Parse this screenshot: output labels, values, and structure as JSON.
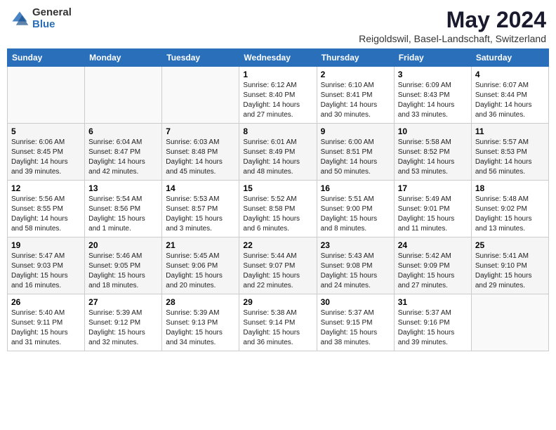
{
  "header": {
    "logo_general": "General",
    "logo_blue": "Blue",
    "month_year": "May 2024",
    "location": "Reigoldswil, Basel-Landschaft, Switzerland"
  },
  "weekdays": [
    "Sunday",
    "Monday",
    "Tuesday",
    "Wednesday",
    "Thursday",
    "Friday",
    "Saturday"
  ],
  "weeks": [
    [
      {
        "day": "",
        "info": ""
      },
      {
        "day": "",
        "info": ""
      },
      {
        "day": "",
        "info": ""
      },
      {
        "day": "1",
        "info": "Sunrise: 6:12 AM\nSunset: 8:40 PM\nDaylight: 14 hours\nand 27 minutes."
      },
      {
        "day": "2",
        "info": "Sunrise: 6:10 AM\nSunset: 8:41 PM\nDaylight: 14 hours\nand 30 minutes."
      },
      {
        "day": "3",
        "info": "Sunrise: 6:09 AM\nSunset: 8:43 PM\nDaylight: 14 hours\nand 33 minutes."
      },
      {
        "day": "4",
        "info": "Sunrise: 6:07 AM\nSunset: 8:44 PM\nDaylight: 14 hours\nand 36 minutes."
      }
    ],
    [
      {
        "day": "5",
        "info": "Sunrise: 6:06 AM\nSunset: 8:45 PM\nDaylight: 14 hours\nand 39 minutes."
      },
      {
        "day": "6",
        "info": "Sunrise: 6:04 AM\nSunset: 8:47 PM\nDaylight: 14 hours\nand 42 minutes."
      },
      {
        "day": "7",
        "info": "Sunrise: 6:03 AM\nSunset: 8:48 PM\nDaylight: 14 hours\nand 45 minutes."
      },
      {
        "day": "8",
        "info": "Sunrise: 6:01 AM\nSunset: 8:49 PM\nDaylight: 14 hours\nand 48 minutes."
      },
      {
        "day": "9",
        "info": "Sunrise: 6:00 AM\nSunset: 8:51 PM\nDaylight: 14 hours\nand 50 minutes."
      },
      {
        "day": "10",
        "info": "Sunrise: 5:58 AM\nSunset: 8:52 PM\nDaylight: 14 hours\nand 53 minutes."
      },
      {
        "day": "11",
        "info": "Sunrise: 5:57 AM\nSunset: 8:53 PM\nDaylight: 14 hours\nand 56 minutes."
      }
    ],
    [
      {
        "day": "12",
        "info": "Sunrise: 5:56 AM\nSunset: 8:55 PM\nDaylight: 14 hours\nand 58 minutes."
      },
      {
        "day": "13",
        "info": "Sunrise: 5:54 AM\nSunset: 8:56 PM\nDaylight: 15 hours\nand 1 minute."
      },
      {
        "day": "14",
        "info": "Sunrise: 5:53 AM\nSunset: 8:57 PM\nDaylight: 15 hours\nand 3 minutes."
      },
      {
        "day": "15",
        "info": "Sunrise: 5:52 AM\nSunset: 8:58 PM\nDaylight: 15 hours\nand 6 minutes."
      },
      {
        "day": "16",
        "info": "Sunrise: 5:51 AM\nSunset: 9:00 PM\nDaylight: 15 hours\nand 8 minutes."
      },
      {
        "day": "17",
        "info": "Sunrise: 5:49 AM\nSunset: 9:01 PM\nDaylight: 15 hours\nand 11 minutes."
      },
      {
        "day": "18",
        "info": "Sunrise: 5:48 AM\nSunset: 9:02 PM\nDaylight: 15 hours\nand 13 minutes."
      }
    ],
    [
      {
        "day": "19",
        "info": "Sunrise: 5:47 AM\nSunset: 9:03 PM\nDaylight: 15 hours\nand 16 minutes."
      },
      {
        "day": "20",
        "info": "Sunrise: 5:46 AM\nSunset: 9:05 PM\nDaylight: 15 hours\nand 18 minutes."
      },
      {
        "day": "21",
        "info": "Sunrise: 5:45 AM\nSunset: 9:06 PM\nDaylight: 15 hours\nand 20 minutes."
      },
      {
        "day": "22",
        "info": "Sunrise: 5:44 AM\nSunset: 9:07 PM\nDaylight: 15 hours\nand 22 minutes."
      },
      {
        "day": "23",
        "info": "Sunrise: 5:43 AM\nSunset: 9:08 PM\nDaylight: 15 hours\nand 24 minutes."
      },
      {
        "day": "24",
        "info": "Sunrise: 5:42 AM\nSunset: 9:09 PM\nDaylight: 15 hours\nand 27 minutes."
      },
      {
        "day": "25",
        "info": "Sunrise: 5:41 AM\nSunset: 9:10 PM\nDaylight: 15 hours\nand 29 minutes."
      }
    ],
    [
      {
        "day": "26",
        "info": "Sunrise: 5:40 AM\nSunset: 9:11 PM\nDaylight: 15 hours\nand 31 minutes."
      },
      {
        "day": "27",
        "info": "Sunrise: 5:39 AM\nSunset: 9:12 PM\nDaylight: 15 hours\nand 32 minutes."
      },
      {
        "day": "28",
        "info": "Sunrise: 5:39 AM\nSunset: 9:13 PM\nDaylight: 15 hours\nand 34 minutes."
      },
      {
        "day": "29",
        "info": "Sunrise: 5:38 AM\nSunset: 9:14 PM\nDaylight: 15 hours\nand 36 minutes."
      },
      {
        "day": "30",
        "info": "Sunrise: 5:37 AM\nSunset: 9:15 PM\nDaylight: 15 hours\nand 38 minutes."
      },
      {
        "day": "31",
        "info": "Sunrise: 5:37 AM\nSunset: 9:16 PM\nDaylight: 15 hours\nand 39 minutes."
      },
      {
        "day": "",
        "info": ""
      }
    ]
  ]
}
